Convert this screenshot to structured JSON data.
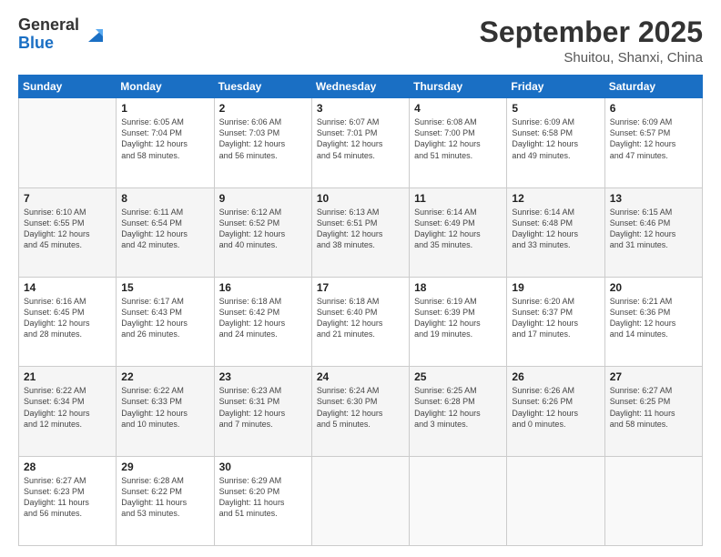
{
  "header": {
    "logo_general": "General",
    "logo_blue": "Blue",
    "month_title": "September 2025",
    "location": "Shuitou, Shanxi, China"
  },
  "days_of_week": [
    "Sunday",
    "Monday",
    "Tuesday",
    "Wednesday",
    "Thursday",
    "Friday",
    "Saturday"
  ],
  "weeks": [
    {
      "shade": false,
      "days": [
        {
          "num": "",
          "info": ""
        },
        {
          "num": "1",
          "info": "Sunrise: 6:05 AM\nSunset: 7:04 PM\nDaylight: 12 hours\nand 58 minutes."
        },
        {
          "num": "2",
          "info": "Sunrise: 6:06 AM\nSunset: 7:03 PM\nDaylight: 12 hours\nand 56 minutes."
        },
        {
          "num": "3",
          "info": "Sunrise: 6:07 AM\nSunset: 7:01 PM\nDaylight: 12 hours\nand 54 minutes."
        },
        {
          "num": "4",
          "info": "Sunrise: 6:08 AM\nSunset: 7:00 PM\nDaylight: 12 hours\nand 51 minutes."
        },
        {
          "num": "5",
          "info": "Sunrise: 6:09 AM\nSunset: 6:58 PM\nDaylight: 12 hours\nand 49 minutes."
        },
        {
          "num": "6",
          "info": "Sunrise: 6:09 AM\nSunset: 6:57 PM\nDaylight: 12 hours\nand 47 minutes."
        }
      ]
    },
    {
      "shade": true,
      "days": [
        {
          "num": "7",
          "info": "Sunrise: 6:10 AM\nSunset: 6:55 PM\nDaylight: 12 hours\nand 45 minutes."
        },
        {
          "num": "8",
          "info": "Sunrise: 6:11 AM\nSunset: 6:54 PM\nDaylight: 12 hours\nand 42 minutes."
        },
        {
          "num": "9",
          "info": "Sunrise: 6:12 AM\nSunset: 6:52 PM\nDaylight: 12 hours\nand 40 minutes."
        },
        {
          "num": "10",
          "info": "Sunrise: 6:13 AM\nSunset: 6:51 PM\nDaylight: 12 hours\nand 38 minutes."
        },
        {
          "num": "11",
          "info": "Sunrise: 6:14 AM\nSunset: 6:49 PM\nDaylight: 12 hours\nand 35 minutes."
        },
        {
          "num": "12",
          "info": "Sunrise: 6:14 AM\nSunset: 6:48 PM\nDaylight: 12 hours\nand 33 minutes."
        },
        {
          "num": "13",
          "info": "Sunrise: 6:15 AM\nSunset: 6:46 PM\nDaylight: 12 hours\nand 31 minutes."
        }
      ]
    },
    {
      "shade": false,
      "days": [
        {
          "num": "14",
          "info": "Sunrise: 6:16 AM\nSunset: 6:45 PM\nDaylight: 12 hours\nand 28 minutes."
        },
        {
          "num": "15",
          "info": "Sunrise: 6:17 AM\nSunset: 6:43 PM\nDaylight: 12 hours\nand 26 minutes."
        },
        {
          "num": "16",
          "info": "Sunrise: 6:18 AM\nSunset: 6:42 PM\nDaylight: 12 hours\nand 24 minutes."
        },
        {
          "num": "17",
          "info": "Sunrise: 6:18 AM\nSunset: 6:40 PM\nDaylight: 12 hours\nand 21 minutes."
        },
        {
          "num": "18",
          "info": "Sunrise: 6:19 AM\nSunset: 6:39 PM\nDaylight: 12 hours\nand 19 minutes."
        },
        {
          "num": "19",
          "info": "Sunrise: 6:20 AM\nSunset: 6:37 PM\nDaylight: 12 hours\nand 17 minutes."
        },
        {
          "num": "20",
          "info": "Sunrise: 6:21 AM\nSunset: 6:36 PM\nDaylight: 12 hours\nand 14 minutes."
        }
      ]
    },
    {
      "shade": true,
      "days": [
        {
          "num": "21",
          "info": "Sunrise: 6:22 AM\nSunset: 6:34 PM\nDaylight: 12 hours\nand 12 minutes."
        },
        {
          "num": "22",
          "info": "Sunrise: 6:22 AM\nSunset: 6:33 PM\nDaylight: 12 hours\nand 10 minutes."
        },
        {
          "num": "23",
          "info": "Sunrise: 6:23 AM\nSunset: 6:31 PM\nDaylight: 12 hours\nand 7 minutes."
        },
        {
          "num": "24",
          "info": "Sunrise: 6:24 AM\nSunset: 6:30 PM\nDaylight: 12 hours\nand 5 minutes."
        },
        {
          "num": "25",
          "info": "Sunrise: 6:25 AM\nSunset: 6:28 PM\nDaylight: 12 hours\nand 3 minutes."
        },
        {
          "num": "26",
          "info": "Sunrise: 6:26 AM\nSunset: 6:26 PM\nDaylight: 12 hours\nand 0 minutes."
        },
        {
          "num": "27",
          "info": "Sunrise: 6:27 AM\nSunset: 6:25 PM\nDaylight: 11 hours\nand 58 minutes."
        }
      ]
    },
    {
      "shade": false,
      "days": [
        {
          "num": "28",
          "info": "Sunrise: 6:27 AM\nSunset: 6:23 PM\nDaylight: 11 hours\nand 56 minutes."
        },
        {
          "num": "29",
          "info": "Sunrise: 6:28 AM\nSunset: 6:22 PM\nDaylight: 11 hours\nand 53 minutes."
        },
        {
          "num": "30",
          "info": "Sunrise: 6:29 AM\nSunset: 6:20 PM\nDaylight: 11 hours\nand 51 minutes."
        },
        {
          "num": "",
          "info": ""
        },
        {
          "num": "",
          "info": ""
        },
        {
          "num": "",
          "info": ""
        },
        {
          "num": "",
          "info": ""
        }
      ]
    }
  ]
}
